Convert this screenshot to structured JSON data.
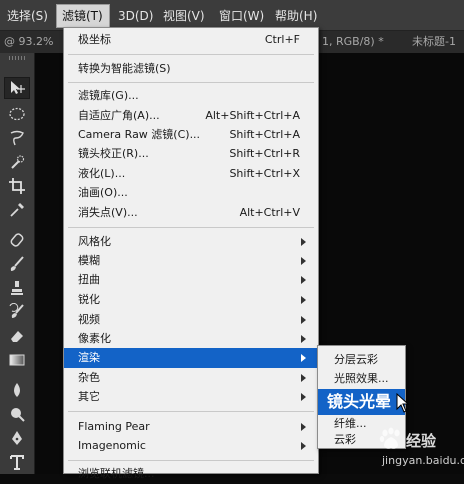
{
  "menubar": {
    "items": [
      {
        "label": "选择(S)"
      },
      {
        "label": "滤镜(T)"
      },
      {
        "label": "3D(D)"
      },
      {
        "label": "视图(V)"
      },
      {
        "label": "窗口(W)"
      },
      {
        "label": "帮助(H)"
      }
    ],
    "active_index": 1
  },
  "tabs": [
    {
      "label": "@ 93.2%"
    },
    {
      "label": "1, RGB/8) *"
    },
    {
      "label": "未标题-1"
    }
  ],
  "filter_menu": {
    "items": [
      {
        "label": "极坐标",
        "shortcut": "Ctrl+F"
      },
      {
        "label": "转换为智能滤镜(S)"
      },
      {
        "label": "滤镜库(G)..."
      },
      {
        "label": "自适应广角(A)...",
        "shortcut": "Alt+Shift+Ctrl+A"
      },
      {
        "label": "Camera Raw 滤镜(C)...",
        "shortcut": "Shift+Ctrl+A"
      },
      {
        "label": "镜头校正(R)...",
        "shortcut": "Shift+Ctrl+R"
      },
      {
        "label": "液化(L)...",
        "shortcut": "Shift+Ctrl+X"
      },
      {
        "label": "油画(O)..."
      },
      {
        "label": "消失点(V)...",
        "shortcut": "Alt+Ctrl+V"
      },
      {
        "label": "风格化"
      },
      {
        "label": "模糊"
      },
      {
        "label": "扭曲"
      },
      {
        "label": "锐化"
      },
      {
        "label": "视频"
      },
      {
        "label": "像素化"
      },
      {
        "label": "渲染"
      },
      {
        "label": "杂色"
      },
      {
        "label": "其它"
      },
      {
        "label": "Flaming Pear"
      },
      {
        "label": "Imagenomic"
      },
      {
        "label": "浏览联机滤镜..."
      }
    ],
    "highlighted": "渲染"
  },
  "render_submenu": {
    "items": [
      {
        "label": "分层云彩"
      },
      {
        "label": "光照效果..."
      },
      {
        "label": "镜头光晕"
      },
      {
        "label": "纤维..."
      },
      {
        "label": "云彩"
      }
    ],
    "highlighted": "镜头光晕"
  },
  "toolbar": {
    "tools": [
      {
        "icon": "move-icon"
      },
      {
        "icon": "elliptical-marquee-icon"
      },
      {
        "icon": "lasso-icon"
      },
      {
        "icon": "quick-selection-icon"
      },
      {
        "icon": "crop-icon"
      },
      {
        "icon": "eyedropper-icon"
      },
      {
        "icon": "healing-brush-icon"
      },
      {
        "icon": "brush-icon"
      },
      {
        "icon": "clone-stamp-icon"
      },
      {
        "icon": "history-brush-icon"
      },
      {
        "icon": "eraser-icon"
      },
      {
        "icon": "gradient-icon"
      },
      {
        "icon": "blur-icon"
      },
      {
        "icon": "dodge-icon"
      },
      {
        "icon": "pen-icon"
      },
      {
        "icon": "type-icon"
      }
    ]
  },
  "watermark": {
    "brand": "经验",
    "url": "jingyan.baidu.com"
  },
  "colors": {
    "menu_highlight": "#1363c7",
    "menu_bg": "#f0f0f0",
    "chrome": "#3c3c3c"
  }
}
